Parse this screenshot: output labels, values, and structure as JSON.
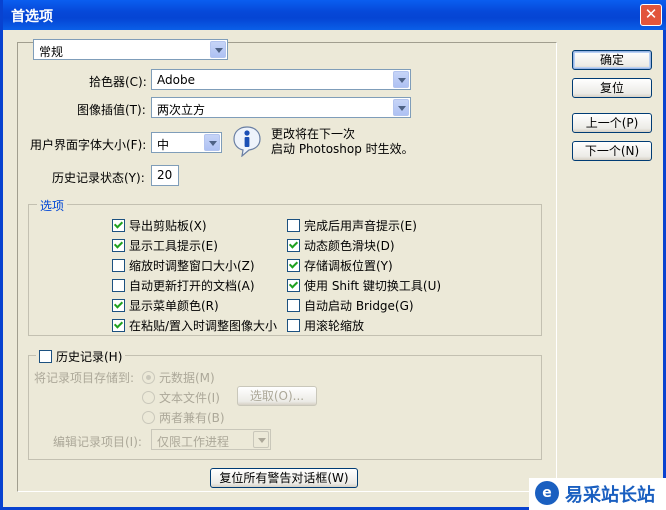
{
  "window": {
    "title": "首选项",
    "close_glyph": "✕"
  },
  "general": {
    "category_value": "常规",
    "color_picker": {
      "label": "拾色器(C):",
      "value": "Adobe"
    },
    "interpolation": {
      "label": "图像插值(T):",
      "value": "两次立方"
    },
    "ui_font_size": {
      "label": "用户界面字体大小(F):",
      "value": "中"
    },
    "info": {
      "line1": "更改将在下一次",
      "line2": "启动 Photoshop 时生效。"
    },
    "history_states": {
      "label": "历史记录状态(Y):",
      "value": "20"
    }
  },
  "options": {
    "title": "选项",
    "left": [
      {
        "label": "导出剪贴板(X)",
        "checked": true
      },
      {
        "label": "显示工具提示(E)",
        "checked": true
      },
      {
        "label": "缩放时调整窗口大小(Z)",
        "checked": false
      },
      {
        "label": "自动更新打开的文档(A)",
        "checked": false
      },
      {
        "label": "显示菜单颜色(R)",
        "checked": true
      },
      {
        "label": "在粘贴/置入时调整图像大小",
        "checked": true
      }
    ],
    "right": [
      {
        "label": "完成后用声音提示(E)",
        "checked": false
      },
      {
        "label": "动态颜色滑块(D)",
        "checked": true
      },
      {
        "label": "存储调板位置(Y)",
        "checked": true
      },
      {
        "label": "使用 Shift 键切换工具(U)",
        "checked": true
      },
      {
        "label": "自动启动 Bridge(G)",
        "checked": false
      },
      {
        "label": "用滚轮缩放",
        "checked": false
      }
    ]
  },
  "history_log": {
    "title": "历史记录(H)",
    "checked": false,
    "save_to_label": "将记录项目存储到:",
    "radio_metadata": "元数据(M)",
    "radio_textfile": "文本文件(I)",
    "radio_both": "两者兼有(B)",
    "choose_button": "选取(O)...",
    "edit_log_label": "编辑记录项目(I):",
    "edit_log_value": "仅限工作进程"
  },
  "reset_warnings_button": "复位所有警告对话框(W)",
  "buttons": {
    "ok": "确定",
    "reset": "复位",
    "prev": "上一个(P)",
    "next": "下一个(N)"
  },
  "watermark": {
    "mark": "e",
    "text": "易采站长站"
  }
}
